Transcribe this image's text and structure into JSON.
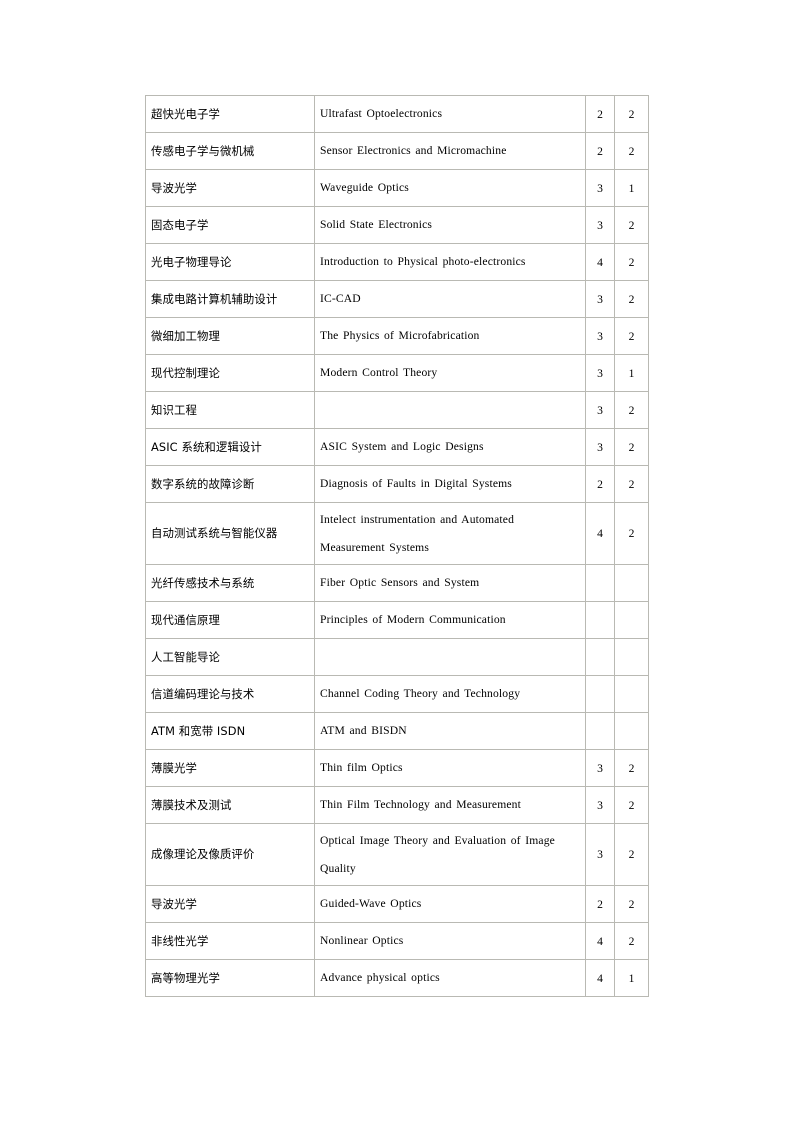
{
  "document": {
    "type": "course-catalog-table",
    "columns": [
      "chinese_name",
      "english_name",
      "credits",
      "semester"
    ]
  },
  "table": {
    "rows": [
      {
        "cn": "超快光电子学",
        "en": "Ultrafast Optoelectronics",
        "credits": "2",
        "semester": "2",
        "tall": false
      },
      {
        "cn": "传感电子学与微机械",
        "en": "Sensor Electronics and Micromachine",
        "credits": "2",
        "semester": "2",
        "tall": false
      },
      {
        "cn": "导波光学",
        "en": "Waveguide Optics",
        "credits": "3",
        "semester": "1",
        "tall": false
      },
      {
        "cn": "固态电子学",
        "en": "Solid State Electronics",
        "credits": "3",
        "semester": "2",
        "tall": false
      },
      {
        "cn": "光电子物理导论",
        "en": "Introduction to Physical photo-electronics",
        "credits": "4",
        "semester": "2",
        "tall": false
      },
      {
        "cn": "集成电路计算机辅助设计",
        "en": "IC-CAD",
        "credits": "3",
        "semester": "2",
        "tall": false
      },
      {
        "cn": "微细加工物理",
        "en": "The Physics of Microfabrication",
        "credits": "3",
        "semester": "2",
        "tall": false
      },
      {
        "cn": "现代控制理论",
        "en": "Modern Control Theory",
        "credits": "3",
        "semester": "1",
        "tall": false
      },
      {
        "cn": "知识工程",
        "en": "",
        "credits": "3",
        "semester": "2",
        "tall": false
      },
      {
        "cn": "ASIC 系统和逻辑设计",
        "en": "ASIC System and Logic Designs",
        "credits": "3",
        "semester": "2",
        "tall": false
      },
      {
        "cn": "数字系统的故障诊断",
        "en": "Diagnosis of Faults in Digital Systems",
        "credits": "2",
        "semester": "2",
        "tall": false
      },
      {
        "cn": "自动测试系统与智能仪器",
        "en": "Intelect instrumentation and Automated Measurement Systems",
        "credits": "4",
        "semester": "2",
        "tall": true
      },
      {
        "cn": "光纤传感技术与系统",
        "en": "Fiber Optic Sensors and System",
        "credits": "",
        "semester": "",
        "tall": false
      },
      {
        "cn": "现代通信原理",
        "en": "Principles of Modern Communication",
        "credits": "",
        "semester": "",
        "tall": false
      },
      {
        "cn": "人工智能导论",
        "en": "",
        "credits": "",
        "semester": "",
        "tall": false
      },
      {
        "cn": "信道编码理论与技术",
        "en": "Channel Coding Theory and Technology",
        "credits": "",
        "semester": "",
        "tall": false
      },
      {
        "cn": "ATM 和宽带 ISDN",
        "en": "ATM and BISDN",
        "credits": "",
        "semester": "",
        "tall": false
      },
      {
        "cn": "薄膜光学",
        "en": "Thin film Optics",
        "credits": "3",
        "semester": "2",
        "tall": false
      },
      {
        "cn": "薄膜技术及测试",
        "en": "Thin Film Technology and Measurement",
        "credits": "3",
        "semester": "2",
        "tall": false
      },
      {
        "cn": "成像理论及像质评价",
        "en": "Optical Image Theory and Evaluation of Image Quality",
        "credits": "3",
        "semester": "2",
        "tall": true
      },
      {
        "cn": "导波光学",
        "en": "Guided-Wave Optics",
        "credits": "2",
        "semester": "2",
        "tall": false
      },
      {
        "cn": "非线性光学",
        "en": "Nonlinear Optics",
        "credits": "4",
        "semester": "2",
        "tall": false
      },
      {
        "cn": "高等物理光学",
        "en": "Advance physical optics",
        "credits": "4",
        "semester": "1",
        "tall": false
      }
    ]
  },
  "colors": {
    "border": "#b9b9b3",
    "outer_border": "#808080",
    "text": "#000000",
    "background": "#ffffff"
  }
}
